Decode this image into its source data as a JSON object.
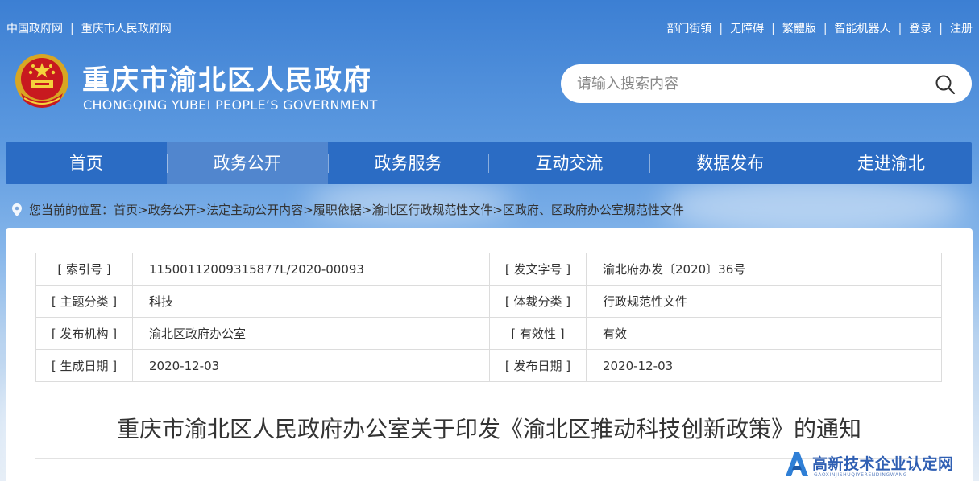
{
  "top_links": {
    "left": [
      "中国政府网",
      "重庆市人民政府网"
    ],
    "right": [
      "部门街镇",
      "无障碍",
      "繁體版",
      "智能机器人",
      "登录",
      "注册"
    ]
  },
  "header": {
    "title": "重庆市渝北区人民政府",
    "subtitle": "CHONGQING YUBEI PEOPLE’S GOVERNMENT"
  },
  "search": {
    "placeholder": "请输入搜索内容"
  },
  "nav": [
    "首页",
    "政务公开",
    "政务服务",
    "互动交流",
    "数据发布",
    "走进渝北"
  ],
  "nav_active_index": 1,
  "breadcrumb": {
    "prefix": "您当前的位置：",
    "items": [
      "首页",
      ">政务公开",
      ">法定主动公开内容",
      ">履职依据",
      ">渝北区行政规范性文件",
      ">区政府、区政府办公室规范性文件"
    ]
  },
  "meta_rows": [
    {
      "label1": "[ 索引号 ]",
      "value1": "11500112009315877L/2020-00093",
      "label2": "[ 发文字号 ]",
      "value2": "渝北府办发〔2020〕36号"
    },
    {
      "label1": "[ 主题分类 ]",
      "value1": "科技",
      "label2": "[ 体裁分类 ]",
      "value2": "行政规范性文件"
    },
    {
      "label1": "[ 发布机构 ]",
      "value1": "渝北区政府办公室",
      "label2": "[ 有效性 ]",
      "value2": "有效"
    },
    {
      "label1": "[ 生成日期 ]",
      "value1": "2020-12-03",
      "label2": "[ 发布日期 ]",
      "value2": "2020-12-03"
    }
  ],
  "doc_title": "重庆市渝北区人民政府办公室关于印发《渝北区推动科技创新政策》的通知",
  "watermark": {
    "text": "高新技术企业认定网",
    "sub": "GAOXINJISHUQIYERENDINGWANG"
  },
  "colors": {
    "nav_bg": "#2b6cc4",
    "watermark": "#2f5fb3"
  }
}
